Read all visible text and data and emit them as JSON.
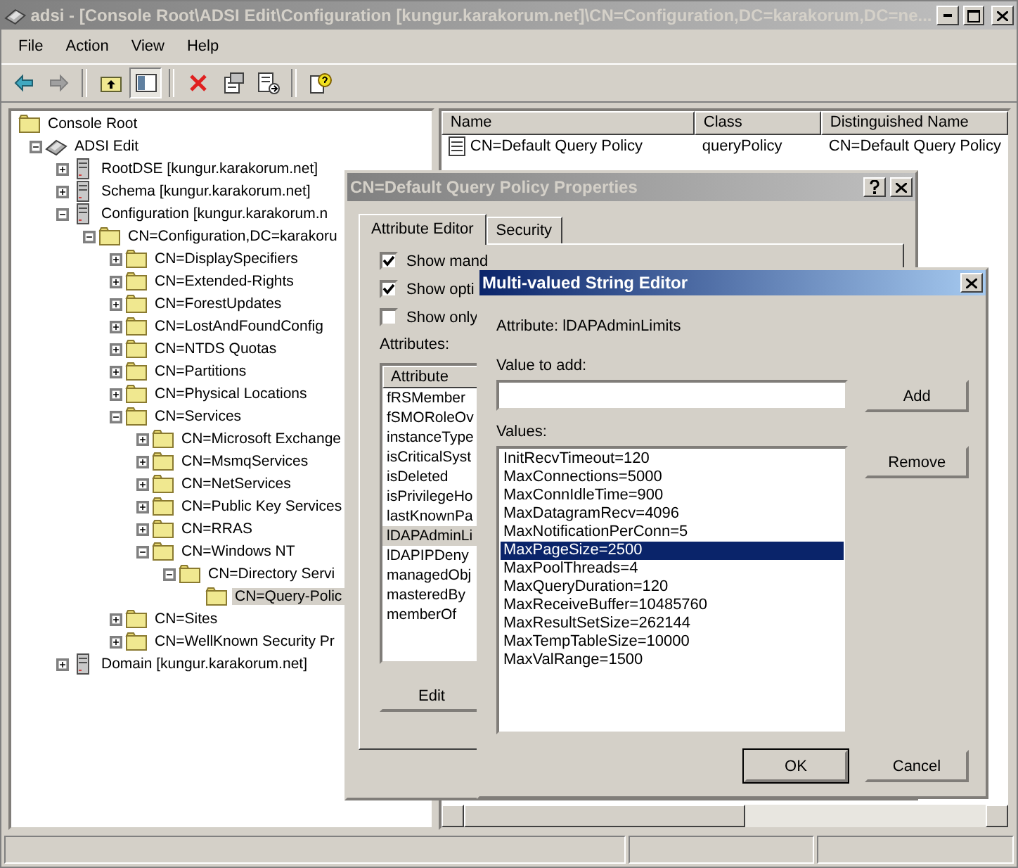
{
  "window": {
    "title": "adsi - [Console Root\\ADSI Edit\\Configuration [kungur.karakorum.net]\\CN=Configuration,DC=karakorum,DC=ne..."
  },
  "menu": [
    "File",
    "Action",
    "View",
    "Help"
  ],
  "toolbar": [
    [
      {
        "kind": "back",
        "pressed": false
      },
      {
        "kind": "forward",
        "pressed": false
      }
    ],
    [
      {
        "kind": "up",
        "pressed": false
      },
      {
        "kind": "tree",
        "pressed": true
      }
    ],
    [
      {
        "kind": "delete",
        "pressed": false
      },
      {
        "kind": "properties",
        "pressed": false
      },
      {
        "kind": "export",
        "pressed": false
      }
    ],
    [
      {
        "kind": "help",
        "pressed": false
      }
    ]
  ],
  "tree": [
    {
      "label": "Console Root",
      "kind": "folder",
      "selected": false,
      "children": [
        {
          "label": "ADSI Edit",
          "kind": "snapin",
          "expanded": true,
          "selected": false,
          "children": [
            {
              "label": "RootDSE [kungur.karakorum.net]",
              "kind": "server",
              "expanded": false,
              "selected": false
            },
            {
              "label": "Schema [kungur.karakorum.net]",
              "kind": "server",
              "expanded": false,
              "selected": false
            },
            {
              "label": "Configuration [kungur.karakorum.n",
              "kind": "server",
              "expanded": true,
              "selected": false,
              "children": [
                {
                  "label": "CN=Configuration,DC=karakoru",
                  "kind": "folder",
                  "expanded": true,
                  "selected": false,
                  "children": [
                    {
                      "label": "CN=DisplaySpecifiers",
                      "kind": "folder",
                      "expanded": false,
                      "selected": false
                    },
                    {
                      "label": "CN=Extended-Rights",
                      "kind": "folder",
                      "expanded": false,
                      "selected": false
                    },
                    {
                      "label": "CN=ForestUpdates",
                      "kind": "folder",
                      "expanded": false,
                      "selected": false
                    },
                    {
                      "label": "CN=LostAndFoundConfig",
                      "kind": "folder",
                      "expanded": false,
                      "selected": false
                    },
                    {
                      "label": "CN=NTDS Quotas",
                      "kind": "folder",
                      "expanded": false,
                      "selected": false
                    },
                    {
                      "label": "CN=Partitions",
                      "kind": "folder",
                      "expanded": false,
                      "selected": false
                    },
                    {
                      "label": "CN=Physical Locations",
                      "kind": "folder",
                      "expanded": false,
                      "selected": false
                    },
                    {
                      "label": "CN=Services",
                      "kind": "folder",
                      "expanded": true,
                      "selected": false,
                      "children": [
                        {
                          "label": "CN=Microsoft Exchange",
                          "kind": "folder",
                          "expanded": false,
                          "selected": false
                        },
                        {
                          "label": "CN=MsmqServices",
                          "kind": "folder",
                          "expanded": false,
                          "selected": false
                        },
                        {
                          "label": "CN=NetServices",
                          "kind": "folder",
                          "expanded": false,
                          "selected": false
                        },
                        {
                          "label": "CN=Public Key Services",
                          "kind": "folder",
                          "expanded": false,
                          "selected": false
                        },
                        {
                          "label": "CN=RRAS",
                          "kind": "folder",
                          "expanded": false,
                          "selected": false
                        },
                        {
                          "label": "CN=Windows NT",
                          "kind": "folder",
                          "expanded": true,
                          "selected": false,
                          "children": [
                            {
                              "label": "CN=Directory Servi",
                              "kind": "folder",
                              "expanded": true,
                              "selected": false,
                              "children": [
                                {
                                  "label": "CN=Query-Polic",
                                  "kind": "folder",
                                  "selected": true
                                }
                              ]
                            }
                          ]
                        }
                      ]
                    },
                    {
                      "label": "CN=Sites",
                      "kind": "folder",
                      "expanded": false,
                      "selected": false
                    },
                    {
                      "label": "CN=WellKnown Security Pr",
                      "kind": "folder",
                      "expanded": false,
                      "selected": false
                    }
                  ]
                }
              ]
            },
            {
              "label": "Domain [kungur.karakorum.net]",
              "kind": "server",
              "expanded": false,
              "selected": false
            }
          ]
        }
      ]
    }
  ],
  "list": {
    "columns": [
      "Name",
      "Class",
      "Distinguished Name"
    ],
    "rows": [
      {
        "cells": [
          "CN=Default Query Policy",
          "queryPolicy",
          "CN=Default Query Policy"
        ]
      }
    ]
  },
  "properties_dialog": {
    "title": "CN=Default Query Policy Properties",
    "tabs": [
      {
        "label": "Attribute Editor",
        "selected": true
      },
      {
        "label": "Security",
        "selected": false
      }
    ],
    "checkboxes": [
      {
        "label": "Show mand",
        "checked": true
      },
      {
        "label": "Show opti",
        "checked": true
      },
      {
        "label": "Show only",
        "checked": false
      }
    ],
    "attributes_label": "Attributes:",
    "column": "Attribute",
    "attributes": [
      {
        "label": "fRSMember",
        "selected": false
      },
      {
        "label": "fSMORoleOv",
        "selected": false
      },
      {
        "label": "instanceType",
        "selected": false
      },
      {
        "label": "isCriticalSyst",
        "selected": false
      },
      {
        "label": "isDeleted",
        "selected": false
      },
      {
        "label": "isPrivilegeHo",
        "selected": false
      },
      {
        "label": "lastKnownPa",
        "selected": false
      },
      {
        "label": "lDAPAdminLi",
        "selected": true
      },
      {
        "label": "lDAPIPDeny",
        "selected": false
      },
      {
        "label": "managedObj",
        "selected": false
      },
      {
        "label": "masteredBy",
        "selected": false
      },
      {
        "label": "memberOf",
        "selected": false
      }
    ],
    "edit_button": "Edit"
  },
  "string_editor": {
    "title": "Multi-valued String Editor",
    "attribute": "Attribute:  lDAPAdminLimits",
    "value_label": "Value to add:",
    "add_button": "Add",
    "values_label": "Values:",
    "values": [
      {
        "text": "InitRecvTimeout=120",
        "selected": false
      },
      {
        "text": "MaxConnections=5000",
        "selected": false
      },
      {
        "text": "MaxConnIdleTime=900",
        "selected": false
      },
      {
        "text": "MaxDatagramRecv=4096",
        "selected": false
      },
      {
        "text": "MaxNotificationPerConn=5",
        "selected": false
      },
      {
        "text": "MaxPageSize=2500",
        "selected": true
      },
      {
        "text": "MaxPoolThreads=4",
        "selected": false
      },
      {
        "text": "MaxQueryDuration=120",
        "selected": false
      },
      {
        "text": "MaxReceiveBuffer=10485760",
        "selected": false
      },
      {
        "text": "MaxResultSetSize=262144",
        "selected": false
      },
      {
        "text": "MaxTempTableSize=10000",
        "selected": false
      },
      {
        "text": "MaxValRange=1500",
        "selected": false
      }
    ],
    "remove_button": "Remove",
    "ok_button": "OK",
    "cancel_button": "Cancel"
  }
}
